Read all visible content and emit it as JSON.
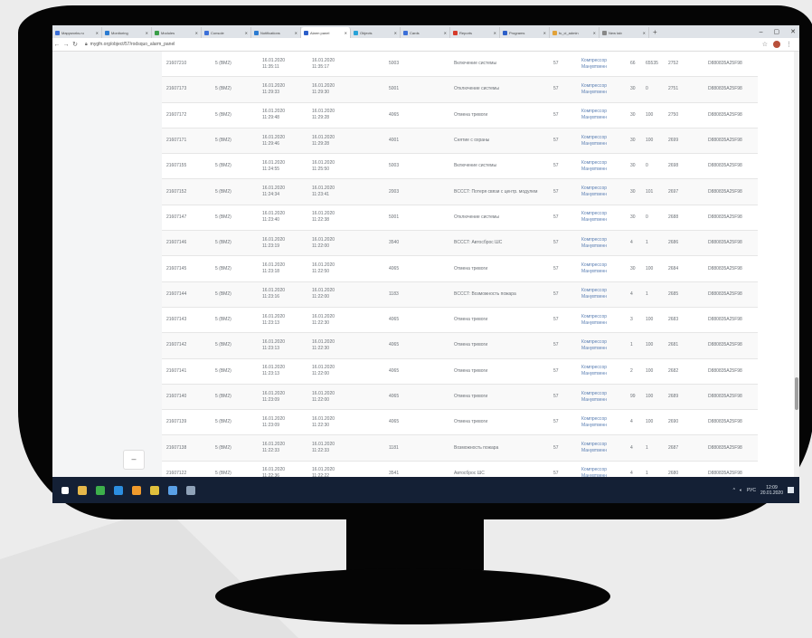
{
  "browser": {
    "tabs": [
      {
        "label": "Mapyworks.ru",
        "color": "#3b6fd8"
      },
      {
        "label": "Monitoring",
        "color": "#2b7bd1"
      },
      {
        "label": "Modules",
        "color": "#3a9e48"
      },
      {
        "label": "Console",
        "color": "#3b6fd8"
      },
      {
        "label": "Notifications",
        "color": "#2b7bd1"
      },
      {
        "label": "Alarm panel",
        "color": "#2c5fc9",
        "active": true
      },
      {
        "label": "Objects",
        "color": "#29a3d8"
      },
      {
        "label": "Cards",
        "color": "#3b6fd8"
      },
      {
        "label": "Reports",
        "color": "#d63b2b"
      },
      {
        "label": "Programs",
        "color": "#2c5fc9"
      },
      {
        "label": "fu_ci_admin",
        "color": "#e2a23a"
      },
      {
        "label": "New tab",
        "color": "#888888"
      }
    ],
    "url": "mygfn.org/object/57/rodsquo_alarm_panel"
  },
  "table": {
    "rows": [
      {
        "id": "21607210",
        "type": "5 (BM2)",
        "t1": "16.01.2020\n11:35:11",
        "t2": "16.01.2020\n11:35:17",
        "code": "5003",
        "event": "Включение системы",
        "num": "57",
        "source": "Компрессор\nМанувтвенн",
        "a": "66",
        "b": "65535",
        "c": "2752",
        "dev": "D880835A25F98"
      },
      {
        "id": "21607173",
        "type": "5 (BM2)",
        "t1": "16.01.2020\n11:29:33",
        "t2": "16.01.2020\n11:29:30",
        "code": "5001",
        "event": "Отключение системы",
        "num": "57",
        "source": "Компрессор\nМанувтвенн",
        "a": "30",
        "b": "0",
        "c": "2751",
        "dev": "D880835A25F98"
      },
      {
        "id": "21607172",
        "type": "5 (BM2)",
        "t1": "16.01.2020\n11:29:48",
        "t2": "16.01.2020\n11:29:28",
        "code": "4065",
        "event": "Отмена тревоги",
        "num": "57",
        "source": "Компрессор\nМанувтвенн",
        "a": "30",
        "b": "100",
        "c": "2750",
        "dev": "D880835A25F98"
      },
      {
        "id": "21607171",
        "type": "5 (BM2)",
        "t1": "16.01.2020\n11:29:46",
        "t2": "16.01.2020\n11:29:28",
        "code": "4001",
        "event": "Снятие с охраны",
        "num": "57",
        "source": "Компрессор\nМанувтвенн",
        "a": "30",
        "b": "100",
        "c": "2699",
        "dev": "D880835A25F98"
      },
      {
        "id": "21607155",
        "type": "5 (BM2)",
        "t1": "16.01.2020\n11:24:55",
        "t2": "16.01.2020\n11:25:50",
        "code": "5003",
        "event": "Включение системы",
        "num": "57",
        "source": "Компрессор\nМанувтвенн",
        "a": "30",
        "b": "0",
        "c": "2698",
        "dev": "D880835A25F98"
      },
      {
        "id": "21607152",
        "type": "5 (BM2)",
        "t1": "16.01.2020\n11:24:34",
        "t2": "16.01.2020\n11:23:41",
        "code": "2003",
        "event": "BCCCT: Потеря связи с центр. модулем",
        "num": "57",
        "source": "Компрессор\nМанувтвенн",
        "a": "30",
        "b": "101",
        "c": "2697",
        "dev": "D880835A25F98"
      },
      {
        "id": "21607147",
        "type": "5 (BM2)",
        "t1": "16.01.2020\n11:23:40",
        "t2": "16.01.2020\n11:22:38",
        "code": "5001",
        "event": "Отключение системы",
        "num": "57",
        "source": "Компрессор\nМанувтвенн",
        "a": "30",
        "b": "0",
        "c": "2688",
        "dev": "D880835A25F98"
      },
      {
        "id": "21607146",
        "type": "5 (BM2)",
        "t1": "16.01.2020\n11:23:19",
        "t2": "16.01.2020\n11:22:00",
        "code": "3540",
        "event": "BCCCT: Автосброс ШС",
        "num": "57",
        "source": "Компрессор\nМанувтвенн",
        "a": "4",
        "b": "1",
        "c": "2686",
        "dev": "D880835A25F98"
      },
      {
        "id": "21607145",
        "type": "5 (BM2)",
        "t1": "16.01.2020\n11:23:18",
        "t2": "16.01.2020\n11:22:50",
        "code": "4065",
        "event": "Отмена тревоги",
        "num": "57",
        "source": "Компрессор\nМанувтвенн",
        "a": "30",
        "b": "100",
        "c": "2684",
        "dev": "D880835A25F98"
      },
      {
        "id": "21607144",
        "type": "5 (BM2)",
        "t1": "16.01.2020\n11:23:16",
        "t2": "16.01.2020\n11:22:00",
        "code": "1183",
        "event": "BCCCT: Возможность пожара",
        "num": "57",
        "source": "Компрессор\nМанувтвенн",
        "a": "4",
        "b": "1",
        "c": "2685",
        "dev": "D880835A25F98"
      },
      {
        "id": "21607143",
        "type": "5 (BM2)",
        "t1": "16.01.2020\n11:23:13",
        "t2": "16.01.2020\n11:22:30",
        "code": "4065",
        "event": "Отмена тревоги",
        "num": "57",
        "source": "Компрессор\nМанувтвенн",
        "a": "3",
        "b": "100",
        "c": "2683",
        "dev": "D880835A25F98"
      },
      {
        "id": "21607142",
        "type": "5 (BM2)",
        "t1": "16.01.2020\n11:23:13",
        "t2": "16.01.2020\n11:22:30",
        "code": "4065",
        "event": "Отмена тревоги",
        "num": "57",
        "source": "Компрессор\nМанувтвенн",
        "a": "1",
        "b": "100",
        "c": "2681",
        "dev": "D880835A25F98"
      },
      {
        "id": "21607141",
        "type": "5 (BM2)",
        "t1": "16.01.2020\n11:23:13",
        "t2": "16.01.2020\n11:22:00",
        "code": "4065",
        "event": "Отмена тревоги",
        "num": "57",
        "source": "Компрессор\nМанувтвенн",
        "a": "2",
        "b": "100",
        "c": "2682",
        "dev": "D880835A25F98"
      },
      {
        "id": "21607140",
        "type": "5 (BM2)",
        "t1": "16.01.2020\n11:23:09",
        "t2": "16.01.2020\n11:22:00",
        "code": "4065",
        "event": "Отмена тревоги",
        "num": "57",
        "source": "Компрессор\nМанувтвенн",
        "a": "99",
        "b": "100",
        "c": "2689",
        "dev": "D880835A25F98"
      },
      {
        "id": "21607139",
        "type": "5 (BM2)",
        "t1": "16.01.2020\n11:23:09",
        "t2": "16.01.2020\n11:22:30",
        "code": "4065",
        "event": "Отмена тревоги",
        "num": "57",
        "source": "Компрессор\nМанувтвенн",
        "a": "4",
        "b": "100",
        "c": "2690",
        "dev": "D880835A25F98"
      },
      {
        "id": "21607138",
        "type": "5 (BM2)",
        "t1": "16.01.2020\n11:22:33",
        "t2": "16.01.2020\n11:22:33",
        "code": "1181",
        "event": "Возможность пожара",
        "num": "57",
        "source": "Компрессор\nМанувтвенн",
        "a": "4",
        "b": "1",
        "c": "2687",
        "dev": "D880835A25F98"
      },
      {
        "id": "21607122",
        "type": "5 (BM2)",
        "t1": "16.01.2020\n11:22:36",
        "t2": "16.01.2020\n11:22:22",
        "code": "3541",
        "event": "Автосброс ШС",
        "num": "57",
        "source": "Компрессор\nМанувтвенн",
        "a": "4",
        "b": "1",
        "c": "2680",
        "dev": "D880835A25F98"
      }
    ]
  },
  "page": {
    "collapse_button": "–"
  },
  "taskbar": {
    "icons": [
      {
        "name": "start-icon",
        "color": "#ffffff"
      },
      {
        "name": "file-explorer-icon",
        "color": "#e6b84a"
      },
      {
        "name": "chrome-icon",
        "color": "#3db04b"
      },
      {
        "name": "app-icon-blue",
        "color": "#2c8ee0"
      },
      {
        "name": "app-icon-ai",
        "color": "#f09a2c"
      },
      {
        "name": "app-icon-yellow",
        "color": "#e0c03c"
      },
      {
        "name": "app-icon-blue2",
        "color": "#5aa0e6"
      },
      {
        "name": "app-icon-gray",
        "color": "#8fa2b8"
      }
    ],
    "lang": "РУС",
    "time": "12:09",
    "date": "20.01.2020"
  }
}
